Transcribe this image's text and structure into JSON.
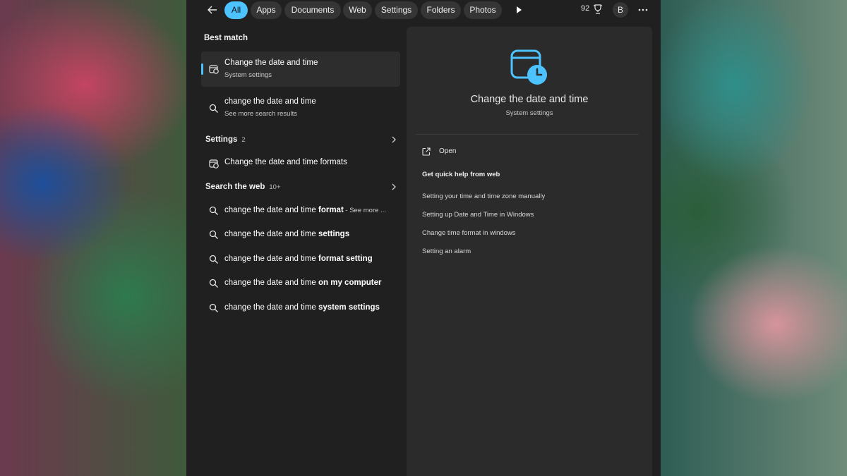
{
  "topbar": {
    "filters": [
      "All",
      "Apps",
      "Documents",
      "Web",
      "Settings",
      "Folders",
      "Photos"
    ],
    "points": "92",
    "avatar_letter": "B"
  },
  "best_match": {
    "heading": "Best match",
    "title": "Change the date and time",
    "subtitle": "System settings"
  },
  "search_suggestion": {
    "title": "change the date and time",
    "subtitle": "See more search results"
  },
  "settings_section": {
    "heading": "Settings",
    "count": "2",
    "item": "Change the date and time formats"
  },
  "web_section": {
    "heading": "Search the web",
    "count": "10+",
    "items": [
      {
        "prefix": "change the date and time",
        "bold": "format",
        "suffix": " - See more ..."
      },
      {
        "prefix": "change the date and time",
        "bold": "settings",
        "suffix": ""
      },
      {
        "prefix": "change the date and time",
        "bold": "format setting",
        "suffix": ""
      },
      {
        "prefix": "change the date and time",
        "bold": "on my computer",
        "suffix": ""
      },
      {
        "prefix": "change the date and time",
        "bold": "system settings",
        "suffix": ""
      }
    ]
  },
  "preview": {
    "title": "Change the date and time",
    "subtitle": "System settings",
    "open_label": "Open",
    "quick_help_title": "Get quick help from web",
    "quick_help_links": [
      "Setting your time and time zone manually",
      "Setting up Date and Time in Windows",
      "Change time format in windows",
      "Setting an alarm"
    ]
  },
  "colors": {
    "accent": "#4cc2ff",
    "panel": "#202020",
    "preview": "#2b2b2b",
    "annotation_arrow": "#e01010"
  }
}
